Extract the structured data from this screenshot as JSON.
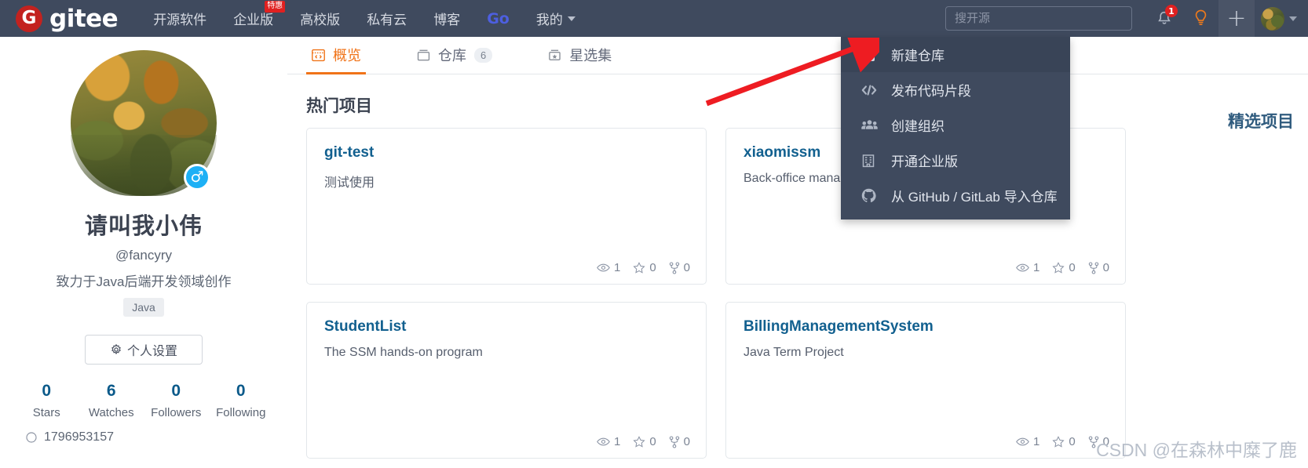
{
  "header": {
    "brand": {
      "logo_letter": "G",
      "name": "gitee"
    },
    "nav": [
      {
        "label": "开源软件",
        "badge": null,
        "icon": null
      },
      {
        "label": "企业版",
        "badge": "特惠",
        "icon": null
      },
      {
        "label": "高校版",
        "badge": null,
        "icon": null
      },
      {
        "label": "私有云",
        "badge": null,
        "icon": null
      },
      {
        "label": "博客",
        "badge": null,
        "icon": null
      },
      {
        "label": "Go",
        "badge": null,
        "icon": null
      },
      {
        "label": "我的",
        "badge": null,
        "icon": "chevron-down-icon"
      }
    ],
    "search": {
      "placeholder": "搜开源",
      "value": "",
      "icon": "search-icon"
    },
    "notification": {
      "icon": "bell-icon",
      "count": "1"
    },
    "ideas": {
      "icon": "lightbulb-icon"
    },
    "add": {
      "icon": "plus-icon"
    },
    "account": {
      "icon": "avatar",
      "caret": "chevron-down-icon"
    }
  },
  "dropdown": {
    "items": [
      {
        "label": "新建仓库",
        "icon": "plus-square-icon",
        "highlighted": true
      },
      {
        "label": "发布代码片段",
        "icon": "code-brackets-icon",
        "highlighted": false
      },
      {
        "label": "创建组织",
        "icon": "people-group-icon",
        "highlighted": false
      },
      {
        "label": "开通企业版",
        "icon": "building-icon",
        "highlighted": false
      },
      {
        "label": "从 GitHub / GitLab 导入仓库",
        "icon": "github-icon",
        "highlighted": false
      }
    ]
  },
  "profile": {
    "avatar": "user-avatar",
    "gender_badge": "male-icon",
    "display_name": "请叫我小伟",
    "handle": "@fancyry",
    "bio": "致力于Java后端开发领域创作",
    "tags": [
      "Java"
    ],
    "settings_button": {
      "label": "个人设置",
      "icon": "gear-icon"
    },
    "stats": [
      {
        "value": "0",
        "label": "Stars"
      },
      {
        "value": "6",
        "label": "Watches"
      },
      {
        "value": "0",
        "label": "Followers"
      },
      {
        "value": "0",
        "label": "Following"
      }
    ],
    "contact": {
      "icon": "qq-icon",
      "value": "1796953157"
    }
  },
  "main": {
    "tabs": [
      {
        "label": "概览",
        "icon": "overview-code-icon",
        "count": null,
        "active": true
      },
      {
        "label": "仓库",
        "icon": "repo-icon",
        "count": "6",
        "active": false
      },
      {
        "label": "星选集",
        "icon": "star-box-icon",
        "count": null,
        "active": false
      }
    ],
    "section_title": "热门项目",
    "featured_title": "精选项目",
    "cards": [
      {
        "title": "git-test",
        "description": "测试使用",
        "stats": [
          {
            "icon": "eye-icon",
            "value": "1"
          },
          {
            "icon": "star-icon",
            "value": "0"
          },
          {
            "icon": "fork-icon",
            "value": "0"
          }
        ]
      },
      {
        "title": "xiaomissm",
        "description": "Back-office management system",
        "stats": [
          {
            "icon": "eye-icon",
            "value": "1"
          },
          {
            "icon": "star-icon",
            "value": "0"
          },
          {
            "icon": "fork-icon",
            "value": "0"
          }
        ]
      },
      {
        "title": "StudentList",
        "description": "The SSM hands-on program",
        "stats": [
          {
            "icon": "eye-icon",
            "value": "1"
          },
          {
            "icon": "star-icon",
            "value": "0"
          },
          {
            "icon": "fork-icon",
            "value": "0"
          }
        ]
      },
      {
        "title": "BillingManagementSystem",
        "description": "Java Term Project",
        "stats": [
          {
            "icon": "eye-icon",
            "value": "1"
          },
          {
            "icon": "star-icon",
            "value": "0"
          },
          {
            "icon": "fork-icon",
            "value": "0"
          }
        ]
      }
    ]
  },
  "annotation": {
    "arrow": "red-arrow",
    "color": "#ee1c22"
  },
  "watermark": "CSDN @在森林中糜了鹿",
  "colors": {
    "header_bg": "#3f4a5e",
    "accent_orange": "#f07318",
    "link_blue": "#12608f",
    "badge_red": "#e02020",
    "logo_red": "#c3221f"
  }
}
